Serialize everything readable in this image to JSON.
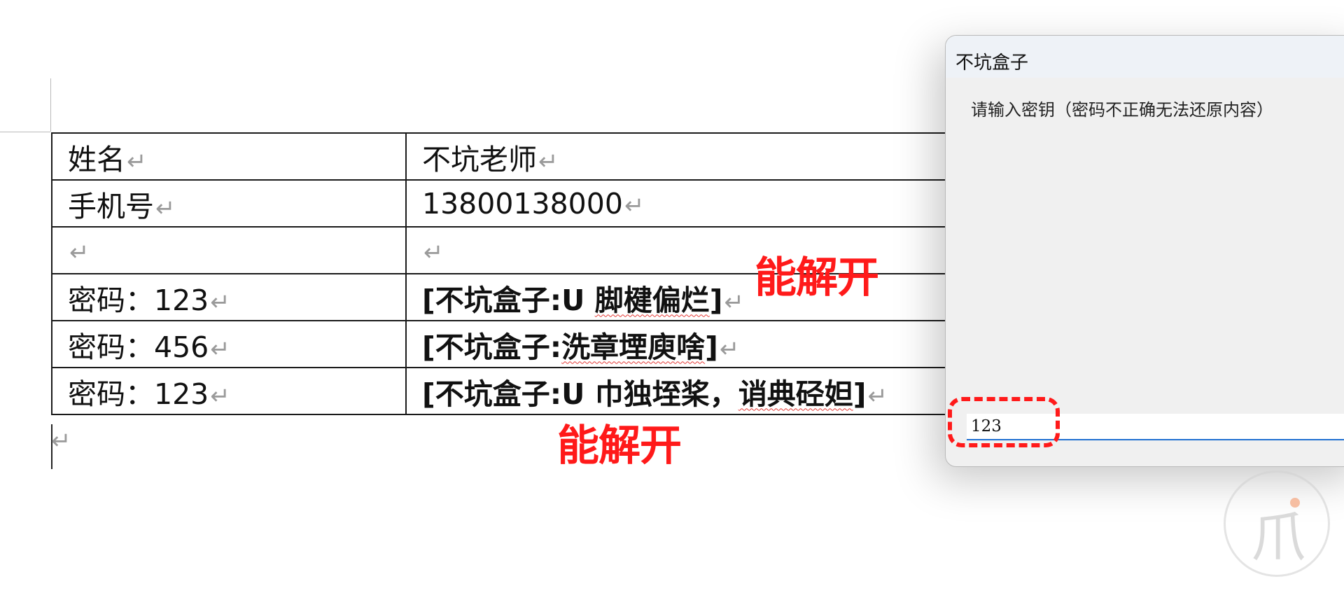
{
  "document": {
    "table": {
      "rows": [
        {
          "label": "姓名",
          "value": "不坑老师",
          "value_bold": false
        },
        {
          "label": "手机号",
          "value": "13800138000",
          "value_bold": false
        },
        {
          "label": "",
          "value": "",
          "value_bold": false
        },
        {
          "label": "密码：123",
          "value_prefix": "[不坑盒子:U ",
          "value_marked": "脚楗偏烂",
          "value_suffix": "]",
          "value_bold": true
        },
        {
          "label": "密码：456",
          "value_prefix": "[不坑盒子:",
          "value_marked": "洗章堙庾啥",
          "value_suffix": "]",
          "value_bold": true
        },
        {
          "label": "密码：123",
          "value_prefix": "[不坑盒子:U 巾独垤桨，",
          "value_marked": "诮典硁妲",
          "value_suffix": "]",
          "value_bold": true
        }
      ]
    },
    "paragraph_mark": "↵"
  },
  "annotations": {
    "top": "能解开",
    "bottom": "能解开",
    "color": "#ff1a1a"
  },
  "dialog": {
    "title": "不坑盒子",
    "prompt": "请输入密钥（密码不正确无法还原内容）",
    "input_value": "123",
    "accent": "#1f6fd1"
  },
  "watermark": {
    "icon": "watermark-logo-icon"
  }
}
